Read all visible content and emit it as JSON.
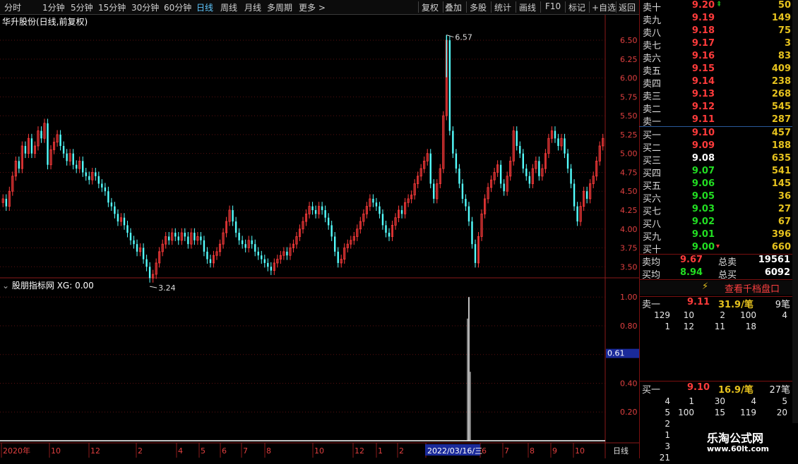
{
  "toolbar": {
    "periods": [
      "分时",
      "1分钟",
      "5分钟",
      "15分钟",
      "30分钟",
      "60分钟",
      "日线",
      "周线",
      "月线",
      "多周期",
      "更多 >"
    ],
    "active_period": "日线",
    "actions": [
      "复权",
      "叠加",
      "多股",
      "统计",
      "画线",
      "F10",
      "标记",
      "+自选",
      "返回"
    ]
  },
  "stock": {
    "title": "华升股份(日线,前复权)"
  },
  "indicator": {
    "title": "股朋指标网 XG: 0.00",
    "marker_value": "0.61"
  },
  "price_axis_labels": [
    "6.50",
    "6.25",
    "6.00",
    "5.75",
    "5.50",
    "5.25",
    "5.00",
    "4.75",
    "4.50",
    "4.25",
    "4.00",
    "3.75",
    "3.50"
  ],
  "indicator_axis_labels": [
    "1.00",
    "0.80",
    "0.60",
    "0.40",
    "0.20"
  ],
  "annotations": {
    "high": "6.57",
    "low": "3.24"
  },
  "time_axis": {
    "labels": [
      "2020年",
      "10",
      "12",
      "2",
      "4",
      "5",
      "6",
      "7",
      "8",
      "10",
      "12",
      "1",
      "2",
      "4",
      "6",
      "7",
      "8",
      "9",
      "10"
    ],
    "cursor": "2022/03/16/三",
    "period_label": "日线"
  },
  "order_book": {
    "sell": [
      {
        "label": "卖十",
        "price": "9.20",
        "volume": "50"
      },
      {
        "label": "卖九",
        "price": "9.19",
        "volume": "149"
      },
      {
        "label": "卖八",
        "price": "9.18",
        "volume": "75"
      },
      {
        "label": "卖七",
        "price": "9.17",
        "volume": "3"
      },
      {
        "label": "卖六",
        "price": "9.16",
        "volume": "83"
      },
      {
        "label": "卖五",
        "price": "9.15",
        "volume": "409"
      },
      {
        "label": "卖四",
        "price": "9.14",
        "volume": "238"
      },
      {
        "label": "卖三",
        "price": "9.13",
        "volume": "268"
      },
      {
        "label": "卖二",
        "price": "9.12",
        "volume": "545"
      },
      {
        "label": "卖一",
        "price": "9.11",
        "volume": "287"
      }
    ],
    "buy": [
      {
        "label": "买一",
        "price": "9.10",
        "volume": "457"
      },
      {
        "label": "买二",
        "price": "9.09",
        "volume": "188"
      },
      {
        "label": "买三",
        "price": "9.08",
        "volume": "635"
      },
      {
        "label": "买四",
        "price": "9.07",
        "volume": "541"
      },
      {
        "label": "买五",
        "price": "9.06",
        "volume": "145"
      },
      {
        "label": "买六",
        "price": "9.05",
        "volume": "36"
      },
      {
        "label": "买七",
        "price": "9.03",
        "volume": "27"
      },
      {
        "label": "买八",
        "price": "9.02",
        "volume": "67"
      },
      {
        "label": "买九",
        "price": "9.01",
        "volume": "396"
      },
      {
        "label": "买十",
        "price": "9.00",
        "volume": "660"
      }
    ],
    "colors": {
      "up": "#ff3b3b",
      "down": "#22dd22",
      "flat": "#ffffff",
      "volume": "#e6c21e"
    }
  },
  "summary": {
    "sell_avg_label": "卖均",
    "sell_avg": "9.67",
    "total_sell_label": "总卖",
    "total_sell": "19561",
    "buy_avg_label": "买均",
    "buy_avg": "8.94",
    "total_buy_label": "总买",
    "total_buy": "6092"
  },
  "depth_button": {
    "label": "查看千档盘口"
  },
  "queue_sell": {
    "label": "卖一",
    "price": "9.11",
    "per": "31.9/笔",
    "count": "9笔"
  },
  "queue_sell_grid": [
    [
      "129",
      "10",
      "2",
      "100",
      "4"
    ],
    [
      "1",
      "12",
      "11",
      "18",
      ""
    ]
  ],
  "queue_buy": {
    "label": "买一",
    "price": "9.10",
    "per": "16.9/笔",
    "count": "27笔"
  },
  "queue_buy_grid": [
    [
      "4",
      "1",
      "30",
      "4",
      "5"
    ],
    [
      "5",
      "100",
      "15",
      "119",
      "20"
    ],
    [
      "2",
      "",
      "",
      "",
      ""
    ],
    [
      "1",
      "",
      "",
      "",
      ""
    ],
    [
      "3",
      "",
      "",
      "",
      ""
    ],
    [
      "21",
      "",
      "",
      "",
      ""
    ]
  ],
  "watermark": {
    "line1": "乐淘公式网",
    "line2": "www.60lt.com"
  },
  "chart_data": {
    "type": "candlestick",
    "price_range": [
      3.4,
      6.65
    ],
    "closes": [
      4.4,
      4.3,
      4.5,
      4.7,
      4.9,
      4.8,
      5.1,
      5.0,
      5.2,
      5.0,
      5.1,
      5.3,
      5.2,
      5.4,
      4.85,
      5.05,
      5.15,
      5.25,
      5.1,
      5.0,
      4.9,
      5.0,
      4.85,
      4.8,
      4.9,
      4.75,
      4.7,
      4.65,
      4.75,
      4.7,
      4.6,
      4.55,
      4.5,
      4.35,
      4.3,
      4.2,
      4.1,
      4.15,
      4.05,
      3.95,
      3.85,
      3.8,
      3.7,
      3.75,
      3.6,
      3.5,
      3.35,
      3.4,
      3.55,
      3.7,
      3.8,
      3.9,
      3.85,
      3.95,
      3.9,
      3.85,
      3.95,
      3.9,
      3.8,
      3.95,
      3.85,
      3.9,
      3.85,
      3.7,
      3.6,
      3.55,
      3.65,
      3.7,
      3.8,
      3.95,
      4.1,
      4.25,
      4.1,
      3.95,
      3.85,
      3.8,
      3.75,
      3.85,
      3.8,
      3.7,
      3.65,
      3.6,
      3.55,
      3.5,
      3.45,
      3.55,
      3.6,
      3.65,
      3.7,
      3.65,
      3.75,
      3.8,
      3.9,
      4.0,
      4.1,
      4.2,
      4.3,
      4.25,
      4.2,
      4.3,
      4.25,
      4.15,
      4.05,
      3.9,
      3.7,
      3.55,
      3.6,
      3.75,
      3.8,
      3.85,
      3.9,
      4.0,
      4.1,
      4.2,
      4.3,
      4.4,
      4.35,
      4.3,
      4.2,
      4.05,
      3.95,
      3.9,
      4.05,
      4.15,
      4.25,
      4.2,
      4.35,
      4.4,
      4.45,
      4.6,
      4.7,
      4.8,
      4.9,
      5.0,
      4.6,
      4.4,
      4.6,
      4.8,
      5.5,
      6.5,
      5.3,
      5.0,
      4.8,
      4.6,
      4.4,
      4.3,
      4.1,
      3.8,
      3.55,
      3.9,
      4.2,
      4.4,
      4.55,
      4.65,
      4.75,
      4.85,
      4.6,
      4.5,
      4.7,
      4.9,
      5.3,
      5.1,
      5.0,
      4.8,
      4.7,
      4.6,
      4.8,
      4.9,
      4.7,
      4.8,
      5.0,
      5.2,
      5.3,
      5.2,
      5.1,
      5.2,
      5.0,
      4.8,
      4.6,
      4.3,
      4.1,
      4.3,
      4.5,
      4.4,
      4.6,
      4.7,
      4.9,
      5.1,
      5.2
    ],
    "xg_signal": {
      "index": 146,
      "value": 1.0
    },
    "indicator_range": [
      0,
      1.05
    ]
  }
}
